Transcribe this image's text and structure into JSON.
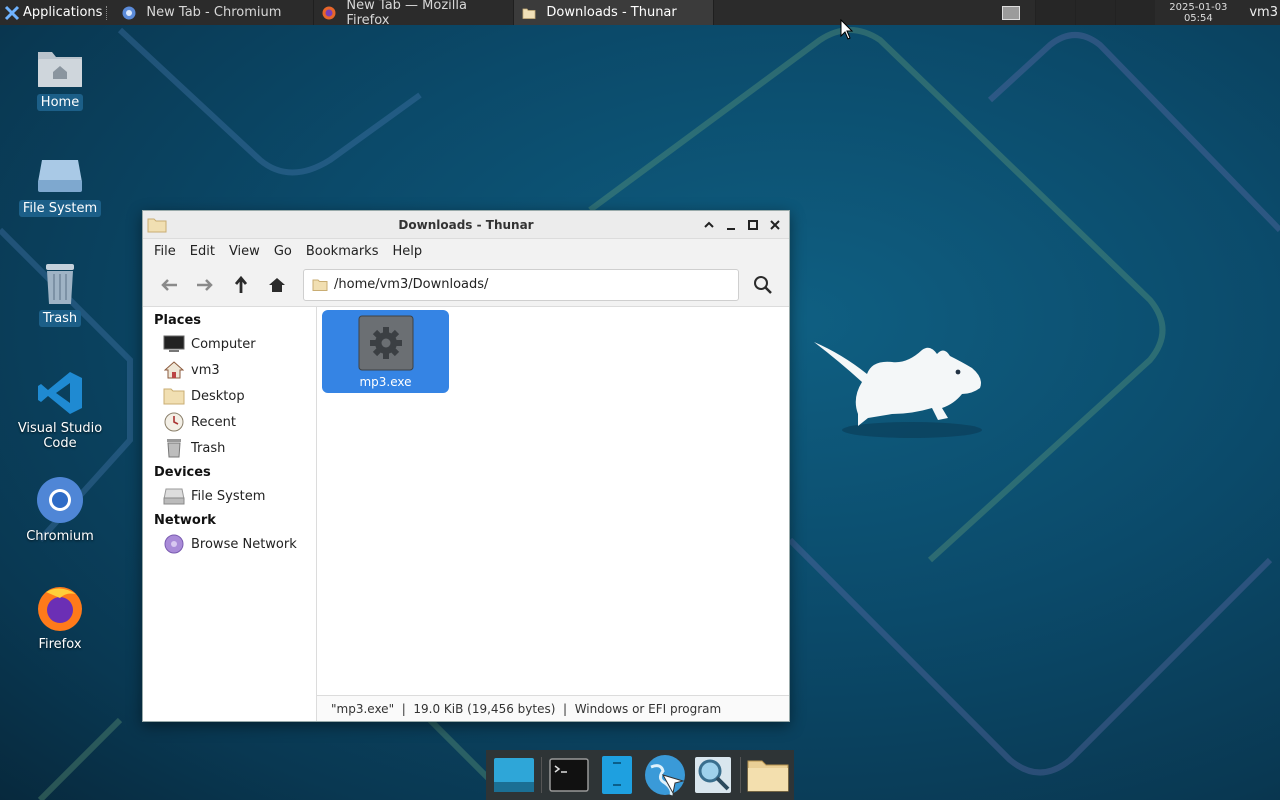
{
  "panel": {
    "applications_label": "Applications",
    "tasks": [
      {
        "label": "New Tab - Chromium"
      },
      {
        "label": "New Tab — Mozilla Firefox"
      },
      {
        "label": "Downloads - Thunar"
      }
    ],
    "clock_date": "2025-01-03",
    "clock_time": "05:54",
    "user": "vm3"
  },
  "desktop_icons": [
    {
      "label": "Home"
    },
    {
      "label": "File System"
    },
    {
      "label": "Trash"
    },
    {
      "label": "Visual Studio Code"
    },
    {
      "label": "Chromium"
    },
    {
      "label": "Firefox"
    }
  ],
  "window": {
    "title": "Downloads - Thunar",
    "menu": [
      "File",
      "Edit",
      "View",
      "Go",
      "Bookmarks",
      "Help"
    ],
    "path": "/home/vm3/Downloads/",
    "sidebar": {
      "places_heading": "Places",
      "places": [
        "Computer",
        "vm3",
        "Desktop",
        "Recent",
        "Trash"
      ],
      "devices_heading": "Devices",
      "devices": [
        "File System"
      ],
      "network_heading": "Network",
      "network": [
        "Browse Network"
      ]
    },
    "files": [
      {
        "name": "mp3.exe"
      }
    ],
    "status": "\"mp3.exe\"  |  19.0 KiB (19,456 bytes)  |  Windows or EFI program"
  },
  "colors": {
    "selection": "#3584e4",
    "panel_bg": "#2b2b2b",
    "desktop_bg": "#0b4a6a"
  }
}
